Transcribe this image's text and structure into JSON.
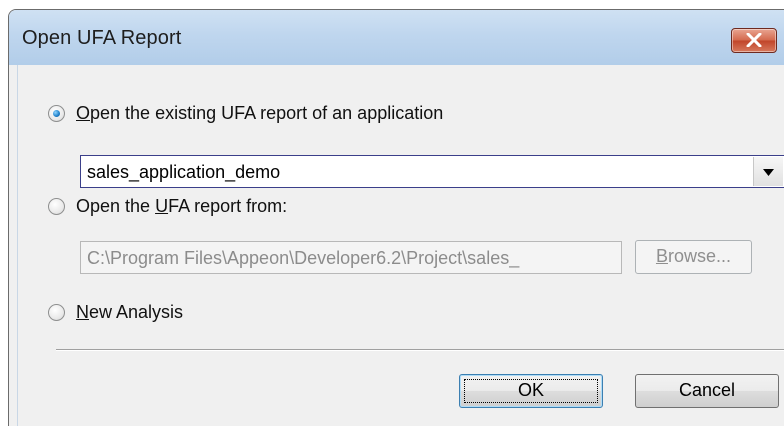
{
  "window": {
    "title": "Open UFA Report",
    "close_icon": "close-x-icon"
  },
  "options": {
    "existing": {
      "prefix": "",
      "mnemonic": "O",
      "rest": "pen the existing UFA report of an application",
      "checked": true
    },
    "from": {
      "prefix": "Open the ",
      "mnemonic": "U",
      "rest": "FA report from:",
      "checked": false
    },
    "new_analysis": {
      "prefix": "",
      "mnemonic": "N",
      "rest": "ew Analysis",
      "checked": false
    }
  },
  "application_select": {
    "value": "sales_application_demo",
    "dropdown_icon": "chevron-down-icon"
  },
  "path_field": {
    "value": "C:\\Program Files\\Appeon\\Developer6.2\\Project\\sales_"
  },
  "buttons": {
    "browse_mnemonic": "B",
    "browse_rest": "rowse...",
    "ok": "OK",
    "cancel": "Cancel"
  },
  "colors": {
    "titlebar": "#bfd6ee",
    "dialog_bg": "#f0f0f0",
    "close_button": "#c8523a",
    "combo_border": "#3b3f8a"
  }
}
